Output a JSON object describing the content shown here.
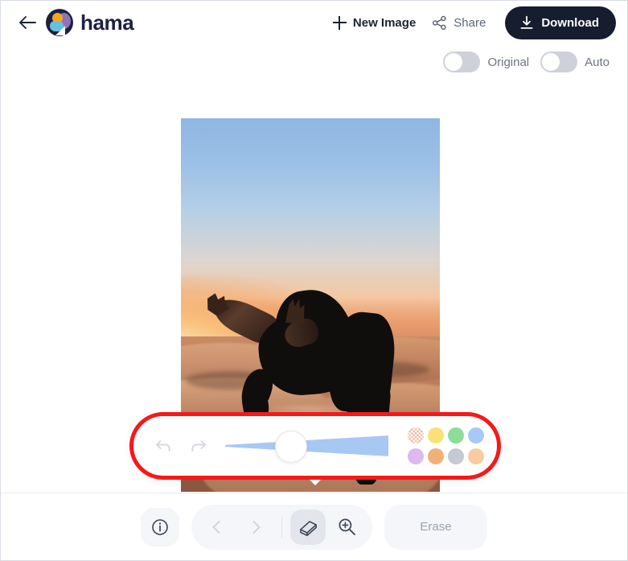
{
  "header": {
    "back_icon": "arrow-left-icon",
    "brand": "hama",
    "new_image": {
      "label": "New Image",
      "icon": "plus-icon"
    },
    "share": {
      "label": "Share",
      "icon": "share-icon"
    },
    "download": {
      "label": "Download",
      "icon": "download-icon"
    }
  },
  "toggles": [
    {
      "label": "Original",
      "state": "off"
    },
    {
      "label": "Auto",
      "state": "off"
    }
  ],
  "canvas": {
    "image_alt": "Person doing a backbend jump silhouetted against a desert sunset"
  },
  "brush_popup": {
    "undo_icon": "undo-arrow-icon",
    "redo_icon": "redo-arrow-icon",
    "slider": {
      "name": "brush-size-slider",
      "value_percent": 40
    },
    "swatches": [
      {
        "name": "swatch-salmon",
        "color": "#f4b39a",
        "selected": true
      },
      {
        "name": "swatch-yellow",
        "color": "#fae177",
        "selected": false
      },
      {
        "name": "swatch-green",
        "color": "#8ddc9a",
        "selected": false
      },
      {
        "name": "swatch-blue",
        "color": "#a9c8f5",
        "selected": false
      },
      {
        "name": "swatch-lavender",
        "color": "#dfb8f0",
        "selected": false
      },
      {
        "name": "swatch-orange",
        "color": "#f0b077",
        "selected": false
      },
      {
        "name": "swatch-gray",
        "color": "#c6cbd2",
        "selected": false
      },
      {
        "name": "swatch-peach",
        "color": "#f9cba1",
        "selected": false
      }
    ]
  },
  "toolbar": {
    "info_icon": "info-icon",
    "prev_icon": "chevron-left-icon",
    "next_icon": "chevron-right-icon",
    "eraser_icon": "eraser-icon",
    "zoom_icon": "zoom-in-icon",
    "erase_label": "Erase"
  },
  "colors": {
    "accent_dark": "#151d2e",
    "annotation_red": "#f71818",
    "muted_text": "#6d7583"
  }
}
